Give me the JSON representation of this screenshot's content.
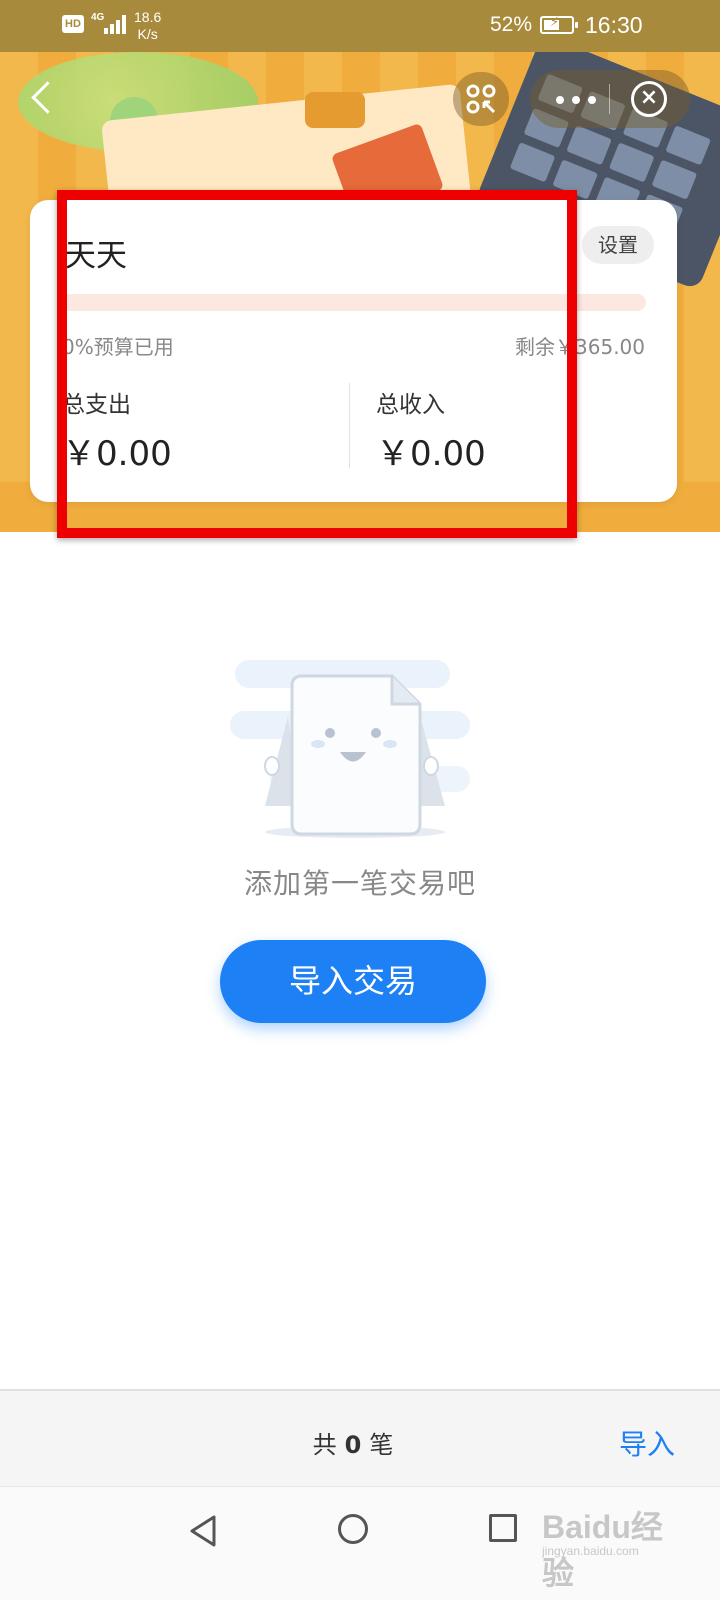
{
  "status_bar": {
    "hd_badge": "HD",
    "network": "4G",
    "speed_value": "18.6",
    "speed_unit": "K/s",
    "battery_percent": "52%",
    "time": "16:30"
  },
  "header": {
    "back_icon": "chevron-left-icon",
    "qr_icon": "scan-icon",
    "more_icon": "more-dots-icon",
    "close_icon": "close-circle-icon"
  },
  "budget_card": {
    "title": "天天",
    "settings_label": "设置",
    "budget_used_text": "0%预算已用",
    "budget_used_fraction": 0,
    "remaining_text": "剩余￥365.00",
    "expense_label": "总支出",
    "expense_value": "￥0.00",
    "income_label": "总收入",
    "income_value": "￥0.00"
  },
  "empty_state": {
    "message": "添加第一笔交易吧",
    "button_label": "导入交易"
  },
  "bottom_bar": {
    "count_prefix": "共",
    "count_value": "0",
    "count_suffix": "笔",
    "import_label": "导入"
  },
  "watermark": {
    "main": "Baidu经验",
    "sub": "jingyan.baidu.com"
  },
  "colors": {
    "accent_blue": "#1e80f5",
    "header_orange": "#f3b84c",
    "annotation_red": "#ee0000",
    "progress_track": "#fde7e1"
  }
}
